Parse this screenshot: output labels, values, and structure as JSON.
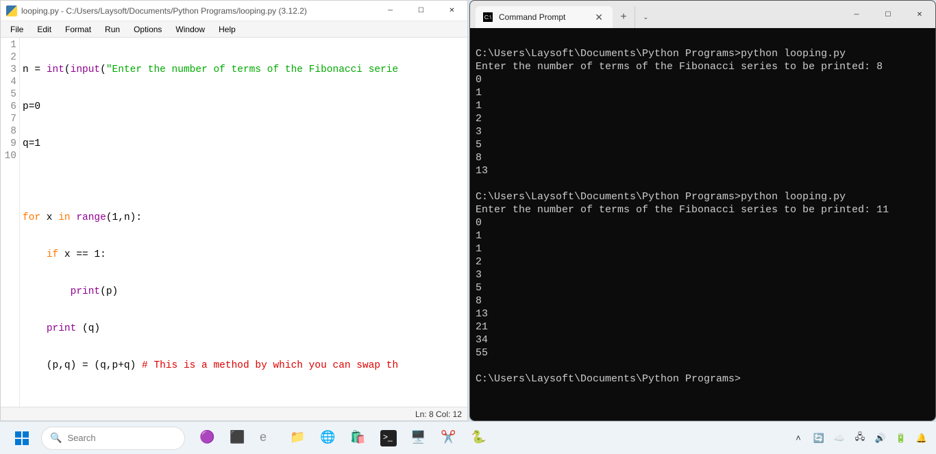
{
  "idle": {
    "title": "looping.py - C:/Users/Laysoft/Documents/Python Programs/looping.py (3.12.2)",
    "menu": [
      "File",
      "Edit",
      "Format",
      "Run",
      "Options",
      "Window",
      "Help"
    ],
    "line_numbers": [
      "1",
      "2",
      "3",
      "4",
      "5",
      "6",
      "7",
      "8",
      "9",
      "10"
    ],
    "code": {
      "l1": {
        "a": "n ",
        "b": "=",
        "c": " ",
        "d": "int",
        "e": "(",
        "f": "input",
        "g": "(",
        "h": "\"Enter the number of terms of the Fibonacci serie"
      },
      "l2": {
        "a": "p",
        "b": "=",
        "c": "0"
      },
      "l3": {
        "a": "q",
        "b": "=",
        "c": "1"
      },
      "l4": "",
      "l5": {
        "a": "for",
        "b": " x ",
        "c": "in",
        "d": " ",
        "e": "range",
        "f": "(",
        "g": "1",
        "h": ",n):"
      },
      "l6": {
        "a": "    ",
        "b": "if",
        "c": " x ",
        "d": "==",
        "e": " ",
        "f": "1",
        "g": ":"
      },
      "l7": {
        "a": "        ",
        "b": "print",
        "c": "(p)"
      },
      "l8": {
        "a": "    ",
        "b": "print",
        "c": " (q)"
      },
      "l9": {
        "a": "    (p,q) ",
        "b": "=",
        "c": " (q,p+q) ",
        "d": "# This is a method by which you can swap th"
      }
    },
    "status": "Ln: 8  Col: 12"
  },
  "cmd": {
    "tab_title": "Command Prompt",
    "output": "C:\\Users\\Laysoft\\Documents\\Python Programs>python looping.py\nEnter the number of terms of the Fibonacci series to be printed: 8\n0\n1\n1\n2\n3\n5\n8\n13\n\nC:\\Users\\Laysoft\\Documents\\Python Programs>python looping.py\nEnter the number of terms of the Fibonacci series to be printed: 11\n0\n1\n1\n2\n3\n5\n8\n13\n21\n34\n55\n\nC:\\Users\\Laysoft\\Documents\\Python Programs>"
  },
  "taskbar": {
    "search_placeholder": "Search"
  }
}
